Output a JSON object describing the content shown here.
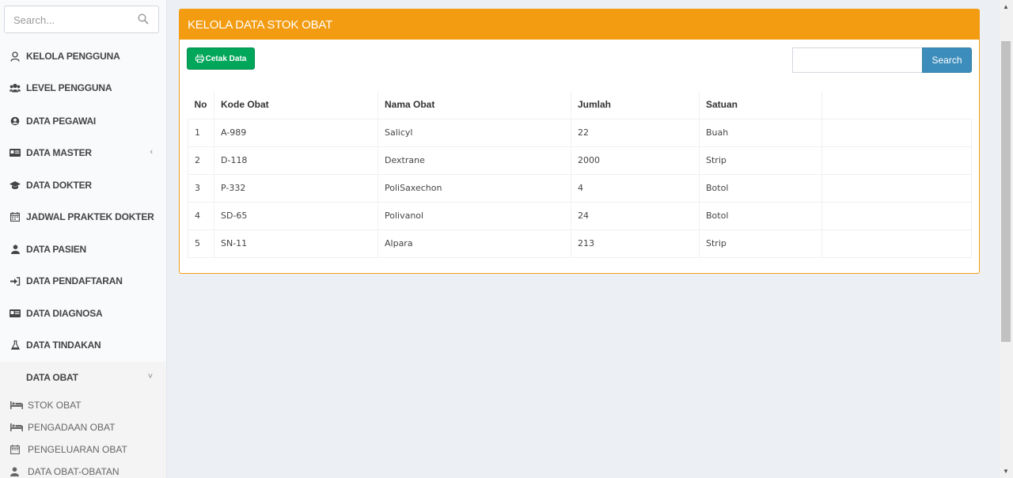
{
  "sidebar": {
    "search_placeholder": "Search...",
    "items": [
      {
        "label": "KELOLA PENGGUNA",
        "icon": "user-outline-icon"
      },
      {
        "label": "LEVEL PENGGUNA",
        "icon": "users-icon"
      },
      {
        "label": "DATA PEGAWAI",
        "icon": "user-circle-icon"
      },
      {
        "label": "DATA MASTER",
        "icon": "id-card-icon",
        "chevron": "‹"
      },
      {
        "label": "DATA DOKTER",
        "icon": "graduation-cap-icon"
      },
      {
        "label": "JADWAL PRAKTEK DOKTER",
        "icon": "calendar-icon"
      },
      {
        "label": "DATA PASIEN",
        "icon": "user-icon"
      },
      {
        "label": "DATA PENDAFTARAN",
        "icon": "sign-in-icon"
      },
      {
        "label": "DATA DIAGNOSA",
        "icon": "id-card-icon"
      },
      {
        "label": "DATA TINDAKAN",
        "icon": "flask-icon"
      },
      {
        "label": "DATA OBAT",
        "icon": "",
        "chevron": "˅"
      }
    ],
    "submenu": [
      {
        "label": "STOK OBAT",
        "icon": "bed-icon"
      },
      {
        "label": "PENGADAAN OBAT",
        "icon": "bed-icon"
      },
      {
        "label": "PENGELUARAN OBAT",
        "icon": "calendar-icon"
      },
      {
        "label": "DATA OBAT-OBATAN",
        "icon": "user-icon"
      }
    ]
  },
  "box": {
    "title": "KELOLA DATA STOK OBAT",
    "print_label": "Cetak Data",
    "search_value": "",
    "search_button": "Search"
  },
  "table": {
    "headers": [
      "No",
      "Kode Obat",
      "Nama Obat",
      "Jumlah",
      "Satuan"
    ],
    "rows": [
      [
        "1",
        "A-989",
        "Salicyl",
        "22",
        "Buah"
      ],
      [
        "2",
        "D-118",
        "Dextrane",
        "2000",
        "Strip"
      ],
      [
        "3",
        "P-332",
        "PoliSaxechon",
        "4",
        "Botol"
      ],
      [
        "4",
        "SD-65",
        "Polivanol",
        "24",
        "Botol"
      ],
      [
        "5",
        "SN-11",
        "Alpara",
        "213",
        "Strip"
      ]
    ]
  },
  "colors": {
    "header": "#f39c12",
    "print_button": "#00a65a",
    "search_button": "#3c8dbc"
  }
}
